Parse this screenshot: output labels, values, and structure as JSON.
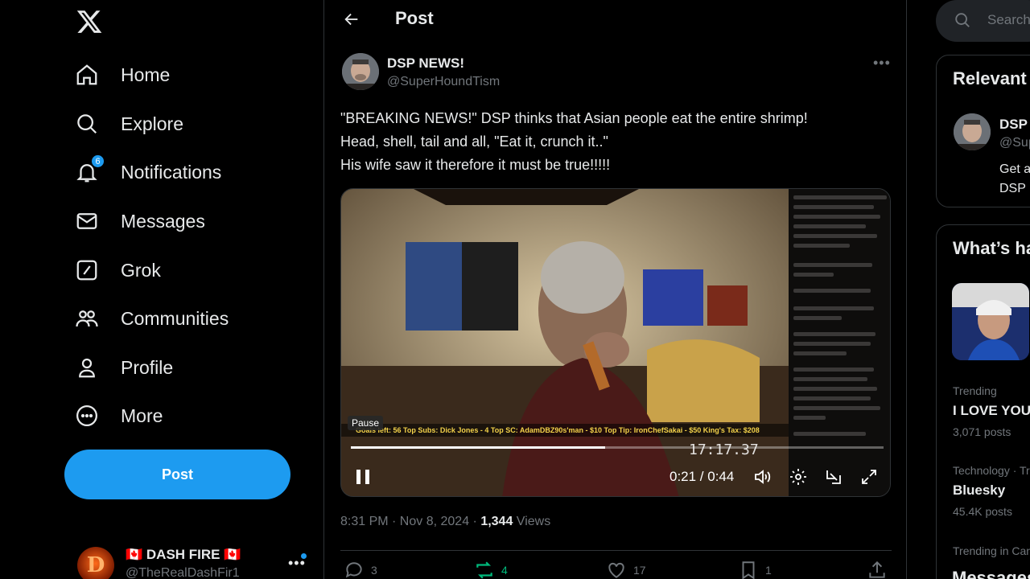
{
  "nav": {
    "logo": "x-logo-icon",
    "items": [
      {
        "label": "Home",
        "icon": "home-icon"
      },
      {
        "label": "Explore",
        "icon": "search-icon"
      },
      {
        "label": "Notifications",
        "icon": "bell-icon",
        "badge": "6"
      },
      {
        "label": "Messages",
        "icon": "envelope-icon"
      },
      {
        "label": "Grok",
        "icon": "grok-icon"
      },
      {
        "label": "Communities",
        "icon": "people-icon"
      },
      {
        "label": "Profile",
        "icon": "person-icon"
      },
      {
        "label": "More",
        "icon": "more-circle-icon"
      }
    ],
    "post_button": "Post"
  },
  "account": {
    "name": "🇨🇦 DASH FIRE 🇨🇦",
    "handle": "@TheRealDashFir1",
    "avatar_letter": "D"
  },
  "header": {
    "title": "Post"
  },
  "post": {
    "author_name": "DSP NEWS!",
    "author_handle": "@SuperHoundTism",
    "text_lines": [
      "\"BREAKING NEWS!\" DSP thinks that Asian people eat the entire shrimp!",
      "Head, shell, tail and all, \"Eat it, crunch it..\"",
      "His wife saw it therefore it must be true!!!!!"
    ],
    "video": {
      "tooltip": "Pause",
      "time": "0:21 / 0:44",
      "progress": 0.477,
      "ticker": "Goals left: 56  Top Subs: Dick Jones - 4   Top SC: AdamDBZ90s'man - $10   Top Tip: IronChefSakai - $50   King's Tax: $208",
      "clock": "17:17.37"
    },
    "time": "8:31 PM · Nov 8, 2024 · ",
    "views_count": "1,344",
    "views_label": " Views",
    "stats": {
      "replies": "3",
      "reposts": "4",
      "likes": "17",
      "bookmarks": "1"
    }
  },
  "right": {
    "search_placeholder": "Search",
    "relevant": {
      "title": "Relevant people",
      "name": "DSP NEWS!",
      "handle": "@SuperHoundTism",
      "bio_line1": "Get all the latest",
      "bio_line2": "DSP news"
    },
    "whats_happening": {
      "title": "What’s happening",
      "trends": [
        {
          "category": "Trending",
          "name": "I LOVE YOU",
          "count": "3,071 posts"
        },
        {
          "category": "Technology · Trending",
          "name": "Bluesky",
          "count": "45.4K posts"
        },
        {
          "category": "Trending in Canada",
          "name": "",
          "count": ""
        }
      ]
    },
    "footer_hint": "Messages"
  },
  "colors": {
    "accent": "#1d9bf0",
    "repost": "#00ba7c",
    "text": "#e7e9ea",
    "muted": "#71767b",
    "border": "#2f3336"
  }
}
